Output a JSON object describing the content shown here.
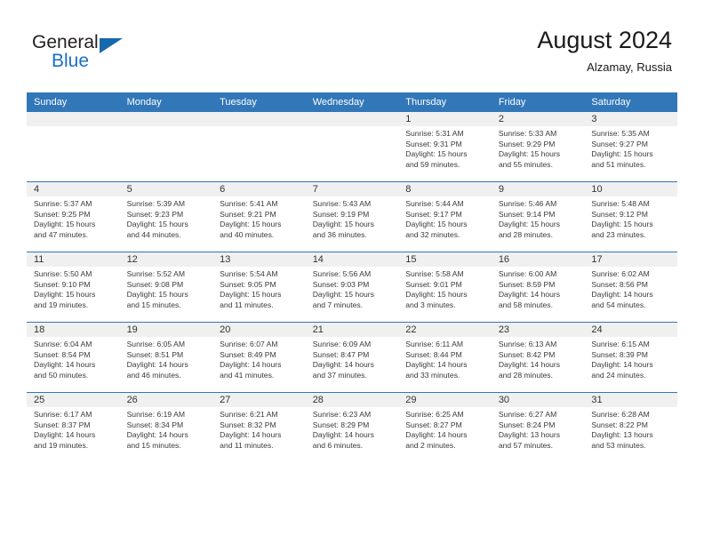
{
  "brand": {
    "word_one": "General",
    "word_two": "Blue",
    "triangle_icon": "triangle-icon",
    "accent_color": "#1a6fc4"
  },
  "header": {
    "title": "August 2024",
    "subtitle": "Alzamay, Russia"
  },
  "colors": {
    "header_row": "#3277b8",
    "day_band": "#f0f0f0",
    "grid_line": "#3277b8",
    "text": "#3a3a3a"
  },
  "weekday_headers": [
    "Sunday",
    "Monday",
    "Tuesday",
    "Wednesday",
    "Thursday",
    "Friday",
    "Saturday"
  ],
  "labels": {
    "sunrise_prefix": "Sunrise:",
    "sunset_prefix": "Sunset:",
    "daylight_prefix": "Daylight:"
  },
  "weeks": [
    [
      {
        "day": "",
        "sunrise": "",
        "sunset": "",
        "daylight_a": "",
        "daylight_b": "",
        "empty": true
      },
      {
        "day": "",
        "sunrise": "",
        "sunset": "",
        "daylight_a": "",
        "daylight_b": "",
        "empty": true
      },
      {
        "day": "",
        "sunrise": "",
        "sunset": "",
        "daylight_a": "",
        "daylight_b": "",
        "empty": true
      },
      {
        "day": "",
        "sunrise": "",
        "sunset": "",
        "daylight_a": "",
        "daylight_b": "",
        "empty": true
      },
      {
        "day": "1",
        "sunrise": "Sunrise: 5:31 AM",
        "sunset": "Sunset: 9:31 PM",
        "daylight_a": "Daylight: 15 hours",
        "daylight_b": "and 59 minutes.",
        "empty": false
      },
      {
        "day": "2",
        "sunrise": "Sunrise: 5:33 AM",
        "sunset": "Sunset: 9:29 PM",
        "daylight_a": "Daylight: 15 hours",
        "daylight_b": "and 55 minutes.",
        "empty": false
      },
      {
        "day": "3",
        "sunrise": "Sunrise: 5:35 AM",
        "sunset": "Sunset: 9:27 PM",
        "daylight_a": "Daylight: 15 hours",
        "daylight_b": "and 51 minutes.",
        "empty": false
      }
    ],
    [
      {
        "day": "4",
        "sunrise": "Sunrise: 5:37 AM",
        "sunset": "Sunset: 9:25 PM",
        "daylight_a": "Daylight: 15 hours",
        "daylight_b": "and 47 minutes.",
        "empty": false
      },
      {
        "day": "5",
        "sunrise": "Sunrise: 5:39 AM",
        "sunset": "Sunset: 9:23 PM",
        "daylight_a": "Daylight: 15 hours",
        "daylight_b": "and 44 minutes.",
        "empty": false
      },
      {
        "day": "6",
        "sunrise": "Sunrise: 5:41 AM",
        "sunset": "Sunset: 9:21 PM",
        "daylight_a": "Daylight: 15 hours",
        "daylight_b": "and 40 minutes.",
        "empty": false
      },
      {
        "day": "7",
        "sunrise": "Sunrise: 5:43 AM",
        "sunset": "Sunset: 9:19 PM",
        "daylight_a": "Daylight: 15 hours",
        "daylight_b": "and 36 minutes.",
        "empty": false
      },
      {
        "day": "8",
        "sunrise": "Sunrise: 5:44 AM",
        "sunset": "Sunset: 9:17 PM",
        "daylight_a": "Daylight: 15 hours",
        "daylight_b": "and 32 minutes.",
        "empty": false
      },
      {
        "day": "9",
        "sunrise": "Sunrise: 5:46 AM",
        "sunset": "Sunset: 9:14 PM",
        "daylight_a": "Daylight: 15 hours",
        "daylight_b": "and 28 minutes.",
        "empty": false
      },
      {
        "day": "10",
        "sunrise": "Sunrise: 5:48 AM",
        "sunset": "Sunset: 9:12 PM",
        "daylight_a": "Daylight: 15 hours",
        "daylight_b": "and 23 minutes.",
        "empty": false
      }
    ],
    [
      {
        "day": "11",
        "sunrise": "Sunrise: 5:50 AM",
        "sunset": "Sunset: 9:10 PM",
        "daylight_a": "Daylight: 15 hours",
        "daylight_b": "and 19 minutes.",
        "empty": false
      },
      {
        "day": "12",
        "sunrise": "Sunrise: 5:52 AM",
        "sunset": "Sunset: 9:08 PM",
        "daylight_a": "Daylight: 15 hours",
        "daylight_b": "and 15 minutes.",
        "empty": false
      },
      {
        "day": "13",
        "sunrise": "Sunrise: 5:54 AM",
        "sunset": "Sunset: 9:05 PM",
        "daylight_a": "Daylight: 15 hours",
        "daylight_b": "and 11 minutes.",
        "empty": false
      },
      {
        "day": "14",
        "sunrise": "Sunrise: 5:56 AM",
        "sunset": "Sunset: 9:03 PM",
        "daylight_a": "Daylight: 15 hours",
        "daylight_b": "and 7 minutes.",
        "empty": false
      },
      {
        "day": "15",
        "sunrise": "Sunrise: 5:58 AM",
        "sunset": "Sunset: 9:01 PM",
        "daylight_a": "Daylight: 15 hours",
        "daylight_b": "and 3 minutes.",
        "empty": false
      },
      {
        "day": "16",
        "sunrise": "Sunrise: 6:00 AM",
        "sunset": "Sunset: 8:59 PM",
        "daylight_a": "Daylight: 14 hours",
        "daylight_b": "and 58 minutes.",
        "empty": false
      },
      {
        "day": "17",
        "sunrise": "Sunrise: 6:02 AM",
        "sunset": "Sunset: 8:56 PM",
        "daylight_a": "Daylight: 14 hours",
        "daylight_b": "and 54 minutes.",
        "empty": false
      }
    ],
    [
      {
        "day": "18",
        "sunrise": "Sunrise: 6:04 AM",
        "sunset": "Sunset: 8:54 PM",
        "daylight_a": "Daylight: 14 hours",
        "daylight_b": "and 50 minutes.",
        "empty": false
      },
      {
        "day": "19",
        "sunrise": "Sunrise: 6:05 AM",
        "sunset": "Sunset: 8:51 PM",
        "daylight_a": "Daylight: 14 hours",
        "daylight_b": "and 46 minutes.",
        "empty": false
      },
      {
        "day": "20",
        "sunrise": "Sunrise: 6:07 AM",
        "sunset": "Sunset: 8:49 PM",
        "daylight_a": "Daylight: 14 hours",
        "daylight_b": "and 41 minutes.",
        "empty": false
      },
      {
        "day": "21",
        "sunrise": "Sunrise: 6:09 AM",
        "sunset": "Sunset: 8:47 PM",
        "daylight_a": "Daylight: 14 hours",
        "daylight_b": "and 37 minutes.",
        "empty": false
      },
      {
        "day": "22",
        "sunrise": "Sunrise: 6:11 AM",
        "sunset": "Sunset: 8:44 PM",
        "daylight_a": "Daylight: 14 hours",
        "daylight_b": "and 33 minutes.",
        "empty": false
      },
      {
        "day": "23",
        "sunrise": "Sunrise: 6:13 AM",
        "sunset": "Sunset: 8:42 PM",
        "daylight_a": "Daylight: 14 hours",
        "daylight_b": "and 28 minutes.",
        "empty": false
      },
      {
        "day": "24",
        "sunrise": "Sunrise: 6:15 AM",
        "sunset": "Sunset: 8:39 PM",
        "daylight_a": "Daylight: 14 hours",
        "daylight_b": "and 24 minutes.",
        "empty": false
      }
    ],
    [
      {
        "day": "25",
        "sunrise": "Sunrise: 6:17 AM",
        "sunset": "Sunset: 8:37 PM",
        "daylight_a": "Daylight: 14 hours",
        "daylight_b": "and 19 minutes.",
        "empty": false
      },
      {
        "day": "26",
        "sunrise": "Sunrise: 6:19 AM",
        "sunset": "Sunset: 8:34 PM",
        "daylight_a": "Daylight: 14 hours",
        "daylight_b": "and 15 minutes.",
        "empty": false
      },
      {
        "day": "27",
        "sunrise": "Sunrise: 6:21 AM",
        "sunset": "Sunset: 8:32 PM",
        "daylight_a": "Daylight: 14 hours",
        "daylight_b": "and 11 minutes.",
        "empty": false
      },
      {
        "day": "28",
        "sunrise": "Sunrise: 6:23 AM",
        "sunset": "Sunset: 8:29 PM",
        "daylight_a": "Daylight: 14 hours",
        "daylight_b": "and 6 minutes.",
        "empty": false
      },
      {
        "day": "29",
        "sunrise": "Sunrise: 6:25 AM",
        "sunset": "Sunset: 8:27 PM",
        "daylight_a": "Daylight: 14 hours",
        "daylight_b": "and 2 minutes.",
        "empty": false
      },
      {
        "day": "30",
        "sunrise": "Sunrise: 6:27 AM",
        "sunset": "Sunset: 8:24 PM",
        "daylight_a": "Daylight: 13 hours",
        "daylight_b": "and 57 minutes.",
        "empty": false
      },
      {
        "day": "31",
        "sunrise": "Sunrise: 6:28 AM",
        "sunset": "Sunset: 8:22 PM",
        "daylight_a": "Daylight: 13 hours",
        "daylight_b": "and 53 minutes.",
        "empty": false
      }
    ]
  ]
}
